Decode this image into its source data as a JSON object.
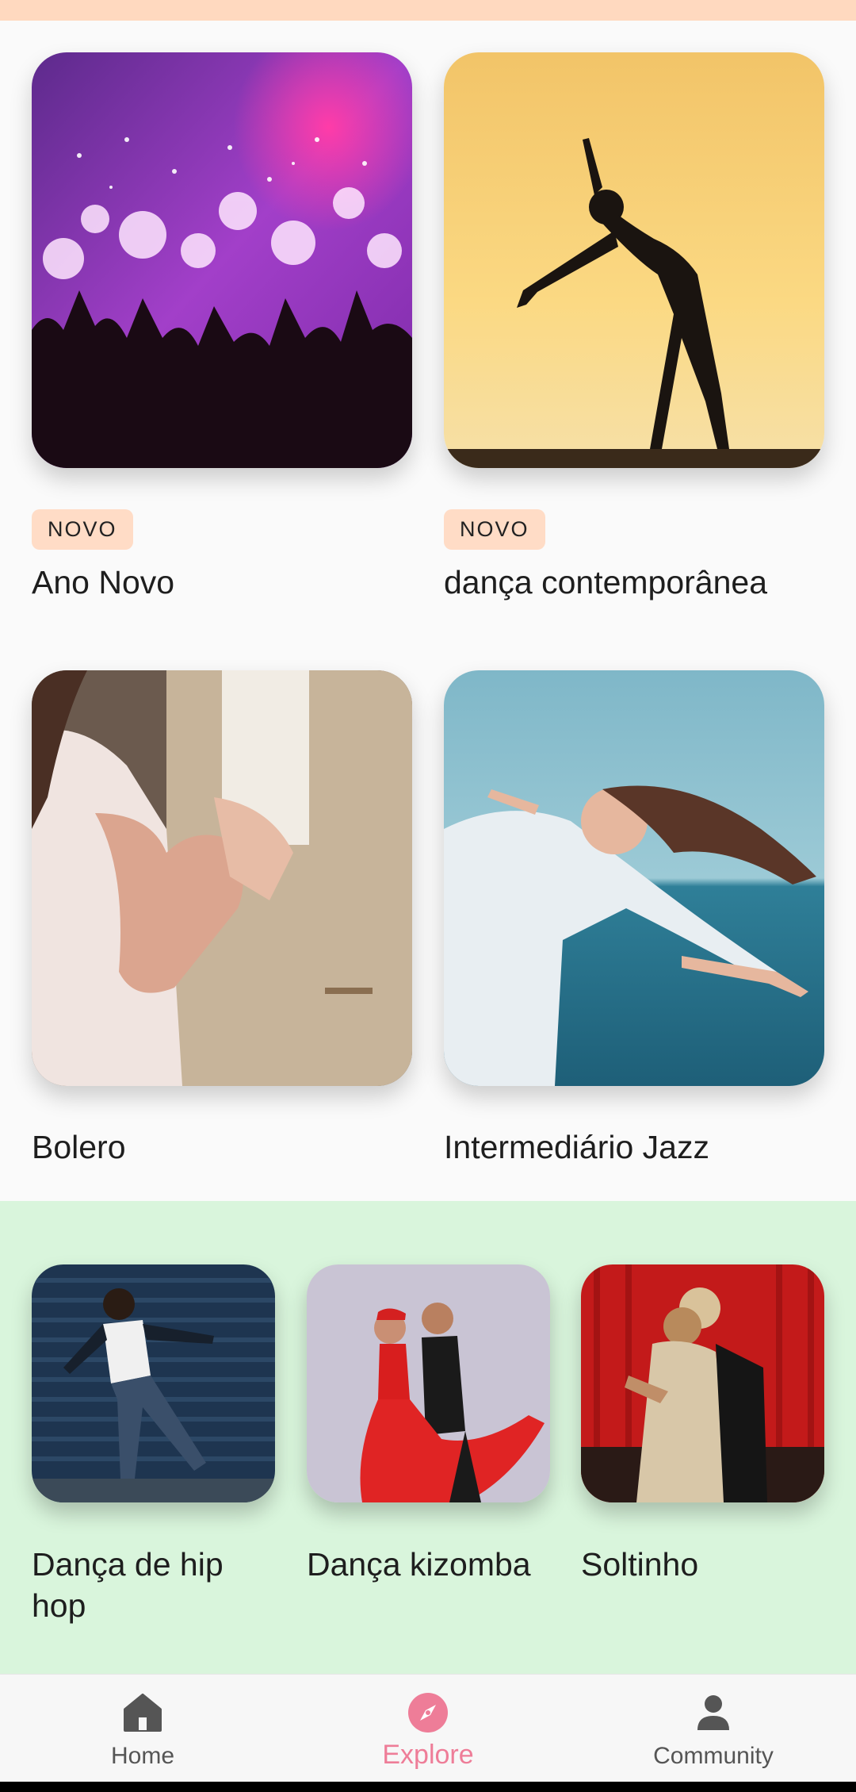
{
  "grid": {
    "cards": [
      {
        "title": "Ano Novo",
        "badge": "NOVO",
        "image": "concert-fireworks-photo"
      },
      {
        "title": "dança contemporânea",
        "badge": "NOVO",
        "image": "dancer-silhouette-sunset-photo"
      },
      {
        "title": "Bolero",
        "image": "couple-holding-hands-photo"
      },
      {
        "title": "Intermediário Jazz",
        "image": "woman-dancing-by-sea-photo"
      }
    ]
  },
  "carousel": {
    "background": "#d9f5dc",
    "cards": [
      {
        "title": "Dança de hip hop",
        "image": "hip-hop-dancer-photo"
      },
      {
        "title": "Dança kizomba",
        "image": "kizomba-couple-photo"
      },
      {
        "title": "Soltinho",
        "image": "ballroom-couple-red-curtain-photo"
      }
    ]
  },
  "bottom_nav": {
    "items": [
      {
        "label": "Home",
        "icon": "home-icon",
        "active": false
      },
      {
        "label": "Explore",
        "icon": "compass-icon",
        "active": true
      },
      {
        "label": "Community",
        "icon": "person-icon",
        "active": false
      }
    ],
    "active_color": "#ee7d98"
  }
}
